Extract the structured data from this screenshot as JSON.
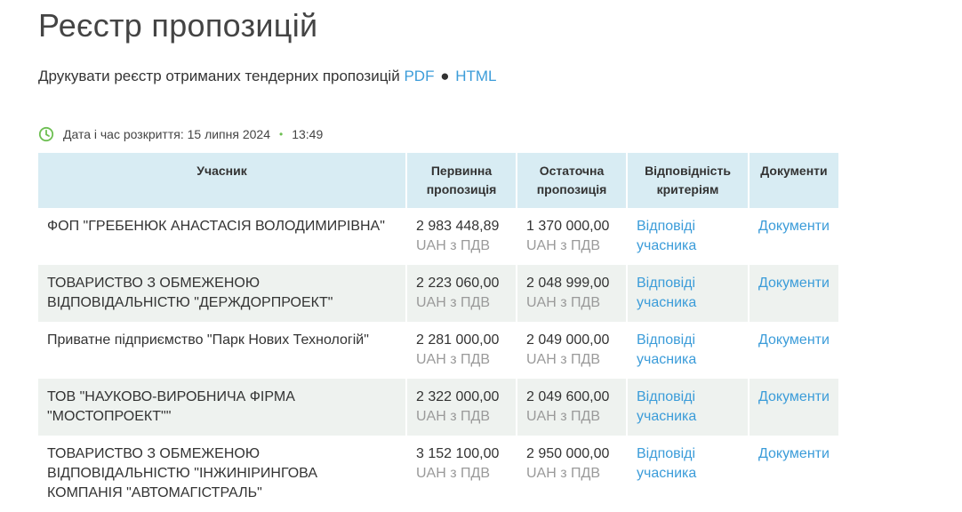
{
  "title": "Реєстр пропозицій",
  "print": {
    "label": "Друкувати реєстр отриманих тендерних пропозицій",
    "pdf": "PDF",
    "separator": "●",
    "html": "HTML"
  },
  "opening": {
    "label": "Дата і час розкриття: 15 липня 2024",
    "time": "13:49",
    "accent_color": "#6dbf52"
  },
  "table": {
    "headers": {
      "participant": "Учасник",
      "initial": "Первинна пропозиція",
      "final": "Остаточна пропозиція",
      "criteria": "Відповідність критеріям",
      "docs": "Документи"
    },
    "rows": [
      {
        "participant": "ФОП \"ГРЕБЕНЮК АНАСТАСІЯ ВОЛОДИМИРІВНА\"",
        "initial": "2 983 448,89",
        "initial_currency": "UAH з ПДВ",
        "final": "1 370 000,00",
        "final_currency": "UAH з ПДВ",
        "criteria": "Відповіді учасника",
        "docs": "Документи"
      },
      {
        "participant": "ТОВАРИСТВО З ОБМЕЖЕНОЮ ВІДПОВІДАЛЬНІСТЮ \"ДЕРЖДОРПРОЕКТ\"",
        "initial": "2 223 060,00",
        "initial_currency": "UAH з ПДВ",
        "final": "2 048 999,00",
        "final_currency": "UAH з ПДВ",
        "criteria": "Відповіді учасника",
        "docs": "Документи"
      },
      {
        "participant": "Приватне підприємство \"Парк Нових Технологій\"",
        "initial": "2 281 000,00",
        "initial_currency": "UAH з ПДВ",
        "final": "2 049 000,00",
        "final_currency": "UAH з ПДВ",
        "criteria": "Відповіді учасника",
        "docs": "Документи"
      },
      {
        "participant": "ТОВ \"НАУКОВО-ВИРОБНИЧА ФІРМА \"МОСТОПРОЕКТ\"\"",
        "initial": "2 322 000,00",
        "initial_currency": "UAH з ПДВ",
        "final": "2 049 600,00",
        "final_currency": "UAH з ПДВ",
        "criteria": "Відповіді учасника",
        "docs": "Документи"
      },
      {
        "participant": "ТОВАРИСТВО З ОБМЕЖЕНОЮ ВІДПОВІДАЛЬНІСТЮ \"ІНЖИНІРИНГОВА КОМПАНІЯ \"АВТОМАГІСТРАЛЬ\"",
        "initial": "3 152 100,00",
        "initial_currency": "UAH з ПДВ",
        "final": "2 950 000,00",
        "final_currency": "UAH з ПДВ",
        "criteria": "Відповіді учасника",
        "docs": "Документи"
      }
    ]
  },
  "colors": {
    "link": "#3b9cd9",
    "header_bg": "#d8ecf3",
    "alt_row_bg": "#eef2ef",
    "muted_text": "#9a9a9a"
  }
}
